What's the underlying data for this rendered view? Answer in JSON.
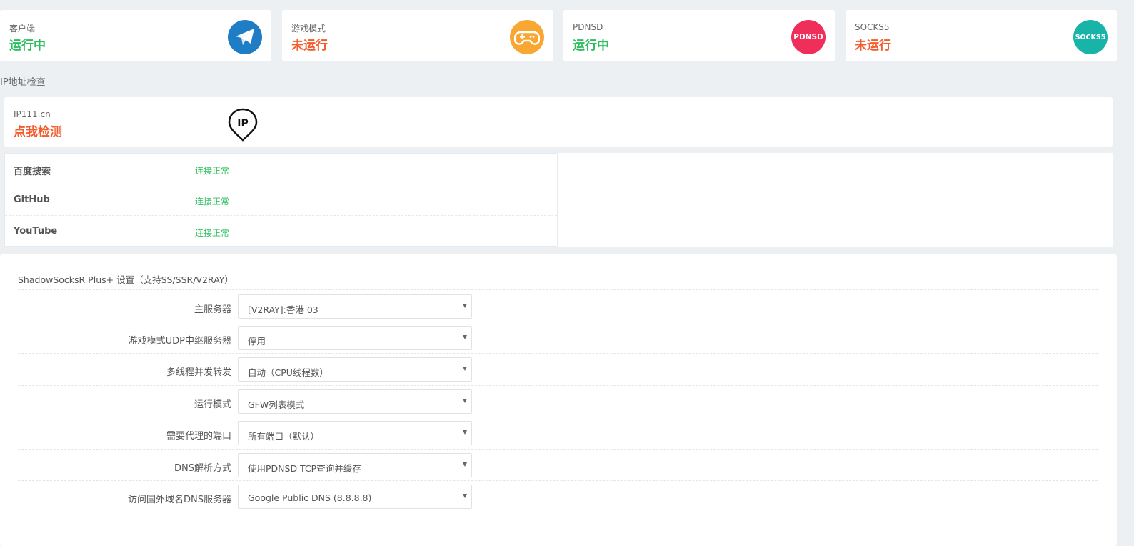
{
  "status_cards": [
    {
      "title": "客户端",
      "status": "运行中",
      "state": "ok",
      "icon": "paper-plane-icon",
      "color": "#1f7dc6"
    },
    {
      "title": "游戏模式",
      "status": "未运行",
      "state": "bad",
      "icon": "gamepad-icon",
      "color": "#f8a732"
    },
    {
      "title": "PDNSD",
      "status": "运行中",
      "state": "ok",
      "icon": "pdnsd-icon",
      "icon_text": "PDNSD",
      "color": "#ef2e5a"
    },
    {
      "title": "SOCKS5",
      "status": "未运行",
      "state": "bad",
      "icon": "socks5-icon",
      "icon_text": "SOCKS5",
      "color": "#19b4a8"
    }
  ],
  "ip_section": {
    "label": "IP地址检查",
    "site": "IP111.cn",
    "action": "点我检测",
    "icon_text": "IP"
  },
  "connections": [
    {
      "name": "百度搜索",
      "state": "连接正常"
    },
    {
      "name": "GitHub",
      "state": "连接正常"
    },
    {
      "name": "YouTube",
      "state": "连接正常"
    }
  ],
  "settings": {
    "title": "ShadowSocksR Plus+ 设置（支持SS/SSR/V2RAY）",
    "rows": [
      {
        "label": "主服务器",
        "value": "[V2RAY]:香港 03"
      },
      {
        "label": "游戏模式UDP中继服务器",
        "value": "停用"
      },
      {
        "label": "多线程并发转发",
        "value": "自动（CPU线程数）"
      },
      {
        "label": "运行模式",
        "value": "GFW列表模式"
      },
      {
        "label": "需要代理的端口",
        "value": "所有端口（默认）"
      },
      {
        "label": "DNS解析方式",
        "value": "使用PDNSD TCP查询并缓存"
      },
      {
        "label": "访问国外域名DNS服务器",
        "value": "Google Public DNS (8.8.8.8)"
      }
    ]
  },
  "colors": {
    "ok": "#2dbf5f",
    "bad": "#f35c2d"
  }
}
